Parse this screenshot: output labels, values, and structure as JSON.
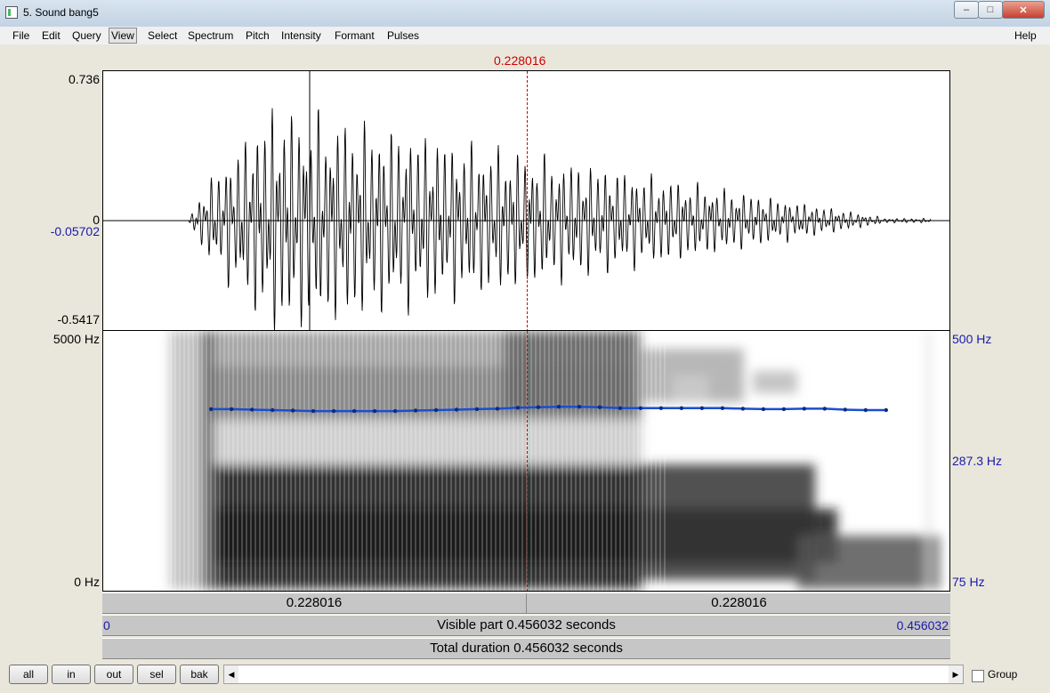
{
  "window": {
    "title": "5. Sound bang5",
    "minimize_glyph": "–",
    "maximize_glyph": "□",
    "close_glyph": "✕"
  },
  "menu": [
    "File",
    "Edit",
    "Query",
    "View",
    "Select",
    "Spectrum",
    "Pitch",
    "Intensity",
    "Formant",
    "Pulses"
  ],
  "help": "Help",
  "cursor": {
    "time_label": "0.228016",
    "time": 0.228016
  },
  "waveform": {
    "max_label": "0.736",
    "zero_label": "0",
    "cursor_value_label": "-0.05702",
    "min_label": "-0.5417"
  },
  "spectrogram": {
    "top_label": "5000 Hz",
    "bottom_label": "0 Hz"
  },
  "pitch": {
    "top_label": "500 Hz",
    "cursor_label": "287.3 Hz",
    "bottom_label": "75 Hz",
    "min_hz": 75,
    "max_hz": 500
  },
  "time_bars": {
    "left_segment": "0.228016",
    "right_segment": "0.228016",
    "visible_part": "Visible part 0.456032 seconds",
    "start": "0",
    "end": "0.456032",
    "total_duration": "Total duration 0.456032 seconds"
  },
  "chart_data": {
    "type": "line",
    "x_range": [
      0,
      0.456032
    ],
    "pitch_track": {
      "x": [
        0.058,
        0.069,
        0.08,
        0.091,
        0.102,
        0.113,
        0.124,
        0.135,
        0.146,
        0.157,
        0.168,
        0.179,
        0.19,
        0.201,
        0.212,
        0.223,
        0.234,
        0.245,
        0.256,
        0.267,
        0.278,
        0.289,
        0.3,
        0.311,
        0.322,
        0.333,
        0.344,
        0.355,
        0.366,
        0.377,
        0.388,
        0.399,
        0.41,
        0.421
      ],
      "hz": [
        283,
        283,
        282,
        281,
        280,
        279,
        279,
        279,
        279,
        279,
        280,
        281,
        282,
        283,
        284,
        286,
        287,
        288,
        288,
        287,
        285,
        285,
        285,
        285,
        285,
        285,
        284,
        283,
        283,
        284,
        284,
        282,
        281,
        281
      ]
    }
  },
  "controls": {
    "buttons": [
      "all",
      "in",
      "out",
      "sel",
      "bak"
    ],
    "group_label": "Group",
    "scroll_left": "◀",
    "scroll_right": "▶"
  }
}
